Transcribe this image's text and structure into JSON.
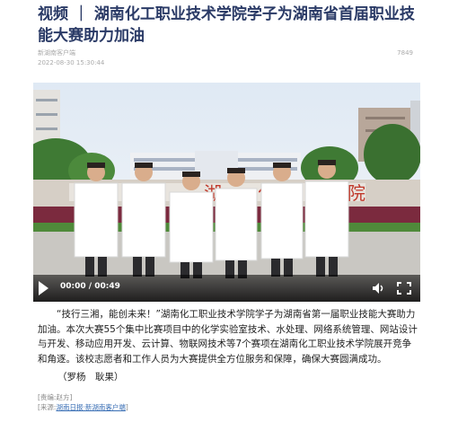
{
  "title": "视频 ｜ 湖南化工职业技术学院学子为湖南省首届职业技能大赛助力加油",
  "meta": {
    "source": "新湖南客户端",
    "date": "2022-08-30 15:30:44",
    "views": "7849"
  },
  "video": {
    "time": "00:00 / 00:49",
    "play_icon": "play-icon",
    "volume_icon": "volume-icon",
    "fullscreen_icon": "fullscreen-icon"
  },
  "article": {
    "body": "“技行三湘，能创未来！”湖南化工职业技术学院学子为湖南省第一届职业技能大赛助力加油。本次大赛55个集中比赛项目中的化学实验室技术、水处理、网络系统管理、网站设计与开发、移动应用开发、云计算、物联网技术等7个赛项在湖南化工职业技术学院展开竞争和角逐。该校志愿者和工作人员为大赛提供全方位服务和保障，确保大赛圆满成功。",
    "byline": "（罗杨　耿果）",
    "editor_label": "[责编:赵方]",
    "source_label": "[来源:",
    "source_link": "湖南日报·新湖南客户端",
    "source_end": "]"
  },
  "colors": {
    "title": "#2a3a66",
    "link": "#3a6fb5"
  }
}
